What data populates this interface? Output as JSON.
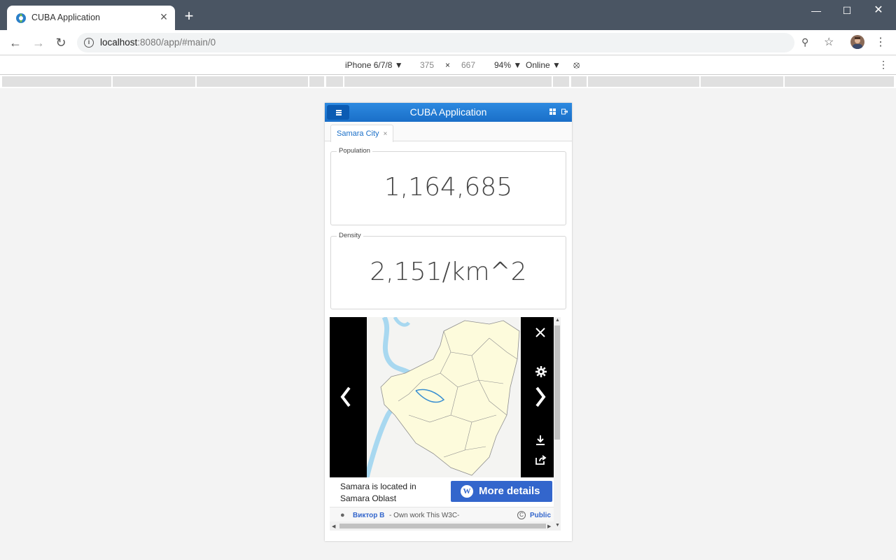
{
  "browser": {
    "tab_title": "CUBA Application",
    "new_tab_icon": "plus-icon",
    "url_host": "localhost",
    "url_rest": ":8080/app/#main/0",
    "window_controls": [
      "minimize-icon",
      "maximize-icon",
      "close-icon"
    ]
  },
  "device_toolbar": {
    "device": "iPhone 6/7/8 ▼",
    "width": "375",
    "times": "×",
    "height": "667",
    "zoom": "94% ▼",
    "network": "Online ▼"
  },
  "app": {
    "title": "CUBA Application",
    "tab_label": "Samara City",
    "tab_close": "×",
    "population": {
      "caption": "Population",
      "value": "1,164,685"
    },
    "density": {
      "caption": "Density",
      "value": "2,151/km^2"
    },
    "media_viewer": {
      "caption": "Samara is located in Samara Oblast",
      "more_details": "More details",
      "author": "Виктор В",
      "attribution_rest": "- Own work This W3C-",
      "license": "Public",
      "map_colors": {
        "land": "#fdfbdc",
        "water": "#a8d8f0",
        "border": "#8f8f8f"
      }
    }
  },
  "colors": {
    "header_blue": "#1a6fc8",
    "button_blue": "#3366cc"
  }
}
